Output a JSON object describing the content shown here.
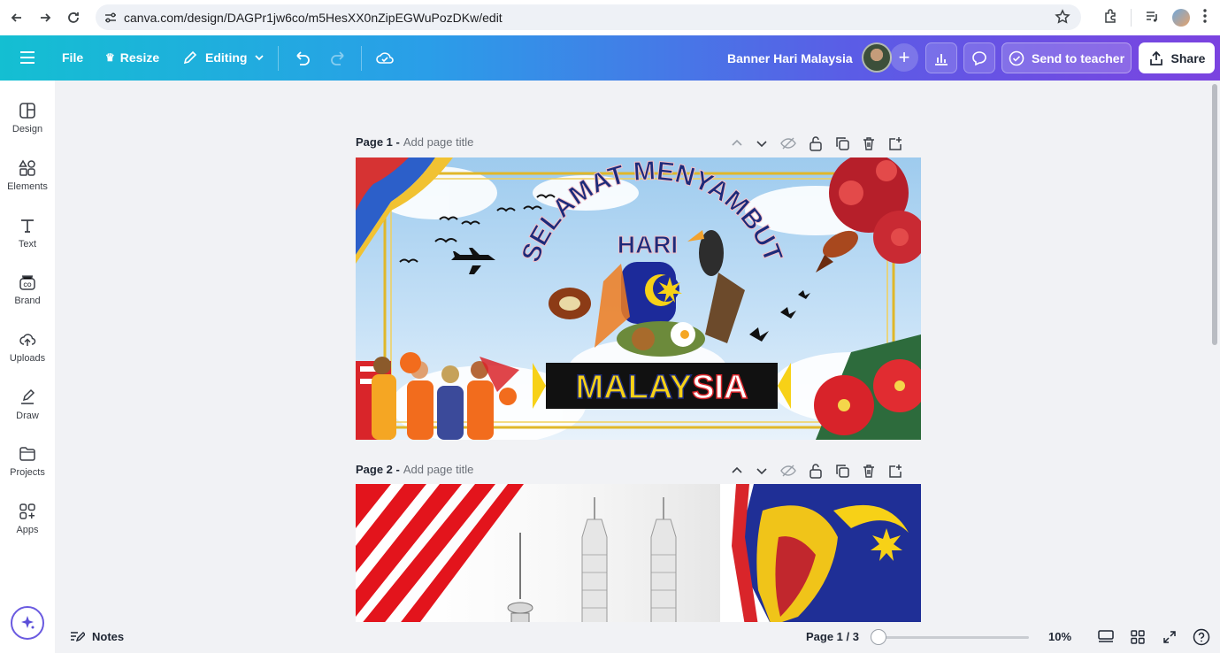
{
  "browser": {
    "url": "canva.com/design/DAGPr1jw6co/m5HesXX0nZipEGWuPozDKw/edit"
  },
  "topbar": {
    "file_label": "File",
    "resize_label": "Resize",
    "editing_label": "Editing",
    "design_title": "Banner Hari Malaysia",
    "send_to_teacher_label": "Send to teacher",
    "share_label": "Share"
  },
  "sidebar": {
    "items": [
      {
        "label": "Design",
        "icon": "design-icon"
      },
      {
        "label": "Elements",
        "icon": "elements-icon"
      },
      {
        "label": "Text",
        "icon": "text-icon"
      },
      {
        "label": "Brand",
        "icon": "brand-icon"
      },
      {
        "label": "Uploads",
        "icon": "uploads-icon"
      },
      {
        "label": "Draw",
        "icon": "draw-icon"
      },
      {
        "label": "Projects",
        "icon": "projects-icon"
      },
      {
        "label": "Apps",
        "icon": "apps-icon"
      }
    ]
  },
  "pages": [
    {
      "title": "Page 1 -",
      "add_title": "Add page title",
      "banner": {
        "arc_text": "SELAMAT MENYAMBUT",
        "middle_text": "HARI",
        "country_text_a": "MALAY",
        "country_text_b": "SIA"
      }
    },
    {
      "title": "Page 2 -",
      "add_title": "Add page title"
    }
  ],
  "bottombar": {
    "notes_label": "Notes",
    "page_indicator": "Page 1 / 3",
    "zoom": "10%",
    "zoom_fraction": 0.0
  },
  "colors": {
    "accent_gradient_start": "#14bfd2",
    "accent_gradient_end": "#7b43e0",
    "banner_navy": "#1c2a7a",
    "malaysia_yellow": "#f7d117",
    "malaysia_red": "#d9252a"
  }
}
